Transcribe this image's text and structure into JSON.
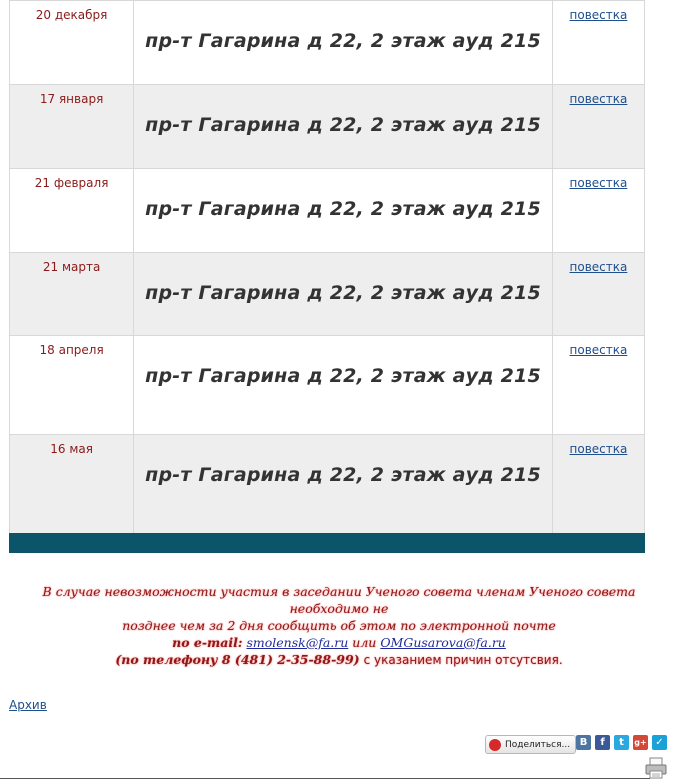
{
  "schedule": {
    "rows": [
      {
        "date": "20 декабря",
        "place": "пр-т Гагарина д 22, 2 этаж ауд 215",
        "link": "повестка"
      },
      {
        "date": "17 января",
        "place": "пр-т Гагарина д 22, 2 этаж ауд 215",
        "link": "повестка"
      },
      {
        "date": "21 февраля",
        "place": "пр-т Гагарина д 22, 2 этаж ауд 215",
        "link": "повестка"
      },
      {
        "date": "21 марта",
        "place": "пр-т Гагарина д 22, 2 этаж ауд 215",
        "link": "повестка"
      },
      {
        "date": "18 апреля",
        "place": "пр-т Гагарина д 22, 2 этаж ауд 215",
        "link": "повестка"
      },
      {
        "date": "16 мая",
        "place": "пр-т Гагарина д 22, 2 этаж ауд 215",
        "link": "повестка"
      }
    ]
  },
  "notice": {
    "line1": "В случае невозможности участия в заседании Ученого совета членам Ученого совета необходимо не",
    "line2": "позднее чем за 2 дня сообщить об этом по электронной почте",
    "email_prefix": "по e-mail:",
    "email1": "smolensk@fa.ru",
    "or": "или",
    "email2": "OMGusarova@fa.ru",
    "phone": "(по телефону  8 (481) 2-35-88-99)",
    "reason": "с указанием причин отсутсвия."
  },
  "archive_label": "Архив",
  "share": {
    "label": "Поделиться...",
    "vk": "В",
    "fb": "f",
    "tw": "t",
    "gp": "g+",
    "ms": "✓"
  },
  "colors": {
    "date_text": "#8b1a1a",
    "footer_bar": "#0b5469",
    "link": "#1f4e8c"
  }
}
